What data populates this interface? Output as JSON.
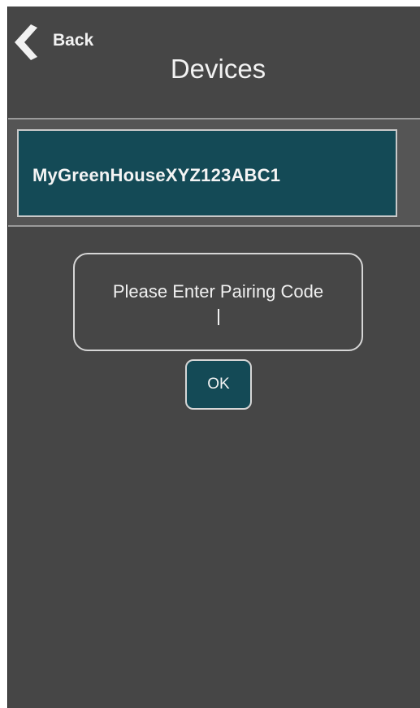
{
  "header": {
    "back_label": "Back",
    "title": "Devices"
  },
  "devices": [
    {
      "name": "MyGreenHouseXYZ123ABC1"
    }
  ],
  "pairing": {
    "prompt": "Please Enter Pairing Code",
    "code_value": "",
    "ok_label": "OK"
  },
  "colors": {
    "background": "#464646",
    "accent": "#144a56",
    "border": "#d6d6d6",
    "text": "#f2f2f2"
  },
  "icons": {
    "back": "chevron-left-icon"
  }
}
